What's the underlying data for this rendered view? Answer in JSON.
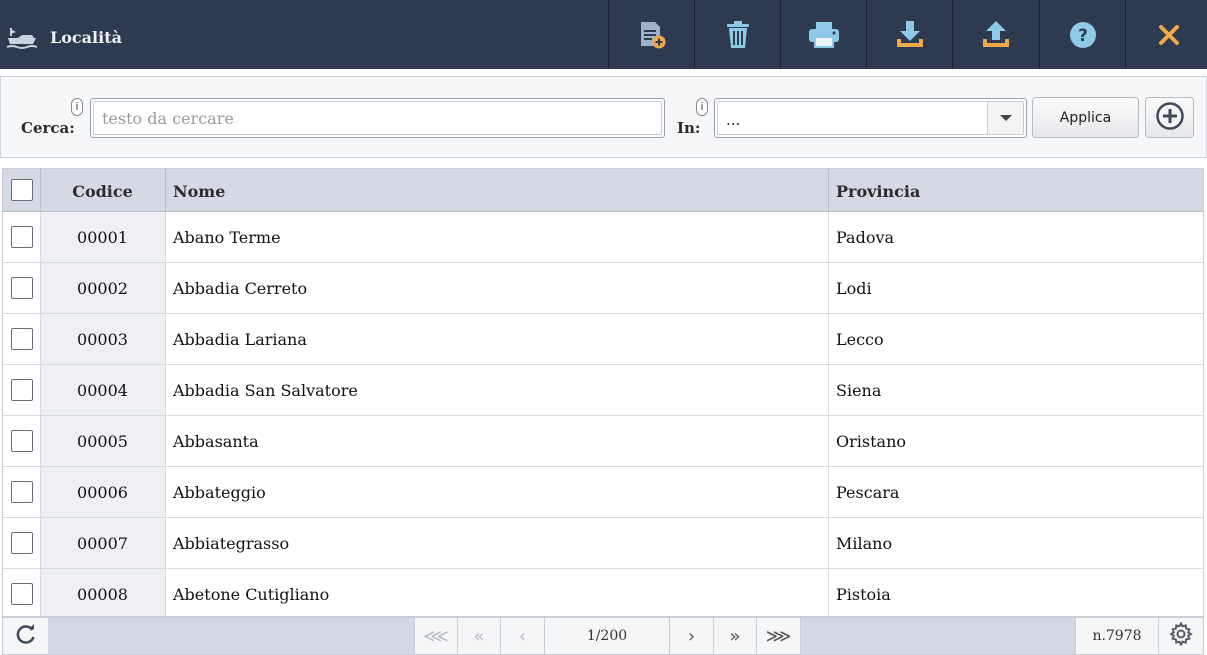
{
  "header": {
    "title": "Località",
    "app_icon": "ship-icon",
    "toolbar": [
      {
        "name": "new-document-button",
        "icon": "new-document-icon"
      },
      {
        "name": "delete-button",
        "icon": "trash-icon"
      },
      {
        "name": "print-button",
        "icon": "printer-icon"
      },
      {
        "name": "download-button",
        "icon": "download-icon"
      },
      {
        "name": "upload-button",
        "icon": "upload-icon"
      },
      {
        "name": "help-button",
        "icon": "help-icon"
      },
      {
        "name": "close-button",
        "icon": "close-icon"
      }
    ],
    "colors": {
      "bar": "#2d3a4f",
      "icon": "#8ec9e6",
      "close": "#f0a94a"
    }
  },
  "search": {
    "cerca_label": "Cerca:",
    "info": "i",
    "placeholder": "testo da cercare",
    "value": "",
    "in_label": "In:",
    "in_value": "...",
    "apply_label": "Applica"
  },
  "table": {
    "columns": [
      "Codice",
      "Nome",
      "Provincia"
    ],
    "rows": [
      {
        "code": "00001",
        "name": "Abano Terme",
        "province": "Padova"
      },
      {
        "code": "00002",
        "name": "Abbadia Cerreto",
        "province": "Lodi"
      },
      {
        "code": "00003",
        "name": "Abbadia Lariana",
        "province": "Lecco"
      },
      {
        "code": "00004",
        "name": "Abbadia San Salvatore",
        "province": "Siena"
      },
      {
        "code": "00005",
        "name": "Abbasanta",
        "province": "Oristano"
      },
      {
        "code": "00006",
        "name": "Abbateggio",
        "province": "Pescara"
      },
      {
        "code": "00007",
        "name": "Abbiategrasso",
        "province": "Milano"
      },
      {
        "code": "00008",
        "name": "Abetone Cutigliano",
        "province": "Pistoia"
      }
    ]
  },
  "footer": {
    "page": "1/200",
    "count": "n.7978",
    "nav": {
      "first_fast": "⋘",
      "first": "«",
      "prev": "‹",
      "next": "›",
      "last": "»",
      "last_fast": "⋙"
    }
  }
}
